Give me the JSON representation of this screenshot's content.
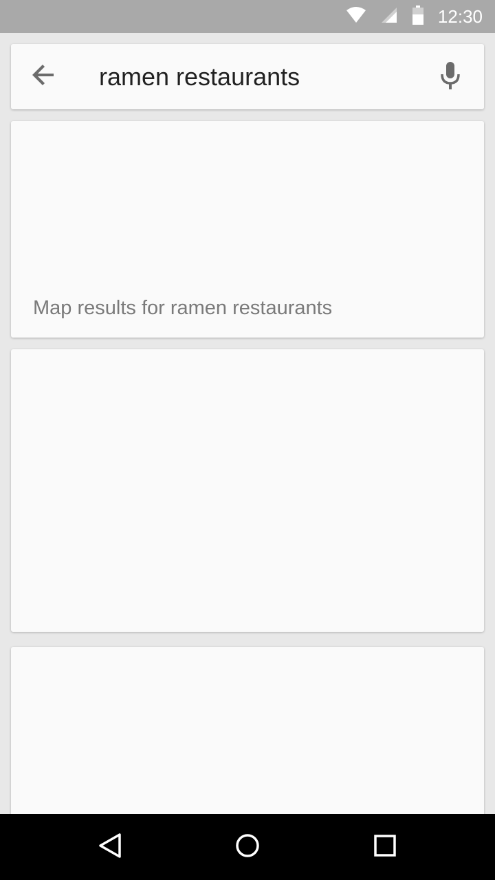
{
  "status_bar": {
    "time": "12:30",
    "icons": [
      "wifi-icon",
      "cell-signal-icon",
      "battery-icon"
    ]
  },
  "search": {
    "query": "ramen restaurants",
    "back_icon": "arrow-back-icon",
    "mic_icon": "microphone-icon"
  },
  "results": {
    "map_caption": "Map results for ramen restaurants"
  },
  "nav_bar": {
    "icons": [
      "nav-back-icon",
      "nav-home-icon",
      "nav-recent-apps-icon"
    ]
  },
  "colors": {
    "status_bar_bg": "#a9a9a9",
    "background": "#e8e8e8",
    "card_bg": "#fafafa",
    "text_primary": "#212121",
    "text_secondary": "#7a7a7a",
    "icon_gray": "#6b6b6b",
    "nav_bar_bg": "#000000"
  }
}
